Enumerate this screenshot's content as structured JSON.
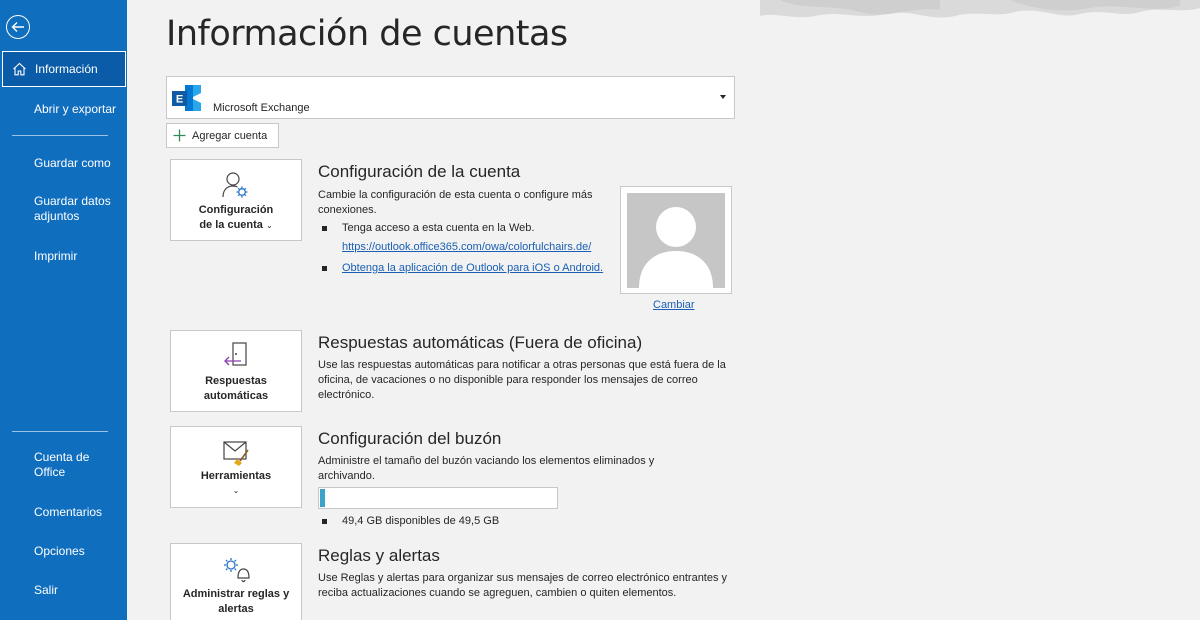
{
  "sidebar": {
    "back_icon": "back-arrow-icon",
    "items": [
      {
        "label": "Información",
        "icon": "home-icon",
        "selected": true
      },
      {
        "label": "Abrir y exportar"
      },
      {
        "label": "Guardar como"
      },
      {
        "label": "Guardar datos adjuntos"
      },
      {
        "label": "Imprimir"
      },
      {
        "label": "Cuenta de Office"
      },
      {
        "label": "Comentarios"
      },
      {
        "label": "Opciones"
      },
      {
        "label": "Salir"
      }
    ]
  },
  "main": {
    "title": "Información de cuentas",
    "account_selector": {
      "value": "Microsoft Exchange",
      "icon": "exchange-logo-icon"
    },
    "add_account_label": "Agregar cuenta",
    "sections": {
      "account_settings": {
        "tile_label": "Configuración de la cuenta",
        "title": "Configuración de la cuenta",
        "text": "Cambie la configuración de esta cuenta o configure más conexiones.",
        "bullet_web": "Tenga acceso a esta cuenta en la Web.",
        "web_link": "https://outlook.office365.com/owa/colorfulchairs.de/",
        "app_link": "Obtenga la aplicación de Outlook para iOS o Android.",
        "change_photo": "Cambiar"
      },
      "auto_replies": {
        "tile_label": "Respuestas automáticas",
        "title": "Respuestas automáticas (Fuera de oficina)",
        "text": "Use las respuestas automáticas para notificar a otras personas que está fuera de la oficina, de vacaciones o no disponible para responder los mensajes de correo electrónico."
      },
      "mailbox": {
        "tile_label": "Herramientas",
        "title": "Configuración del buzón",
        "text": "Administre el tamaño del buzón vaciando los elementos eliminados y archivando.",
        "usage_fraction": 0.02,
        "storage_text": "49,4 GB disponibles de 49,5 GB"
      },
      "rules": {
        "tile_label": "Administrar reglas y alertas",
        "title": "Reglas y alertas",
        "text": "Use Reglas y alertas para organizar sus mensajes de correo electrónico entrantes y reciba actualizaciones cuando se agreguen, cambien o quiten elementos."
      }
    }
  },
  "colors": {
    "sidebar": "#106ebe",
    "link": "#1a5fb4",
    "progress": "#3ba3c9"
  }
}
